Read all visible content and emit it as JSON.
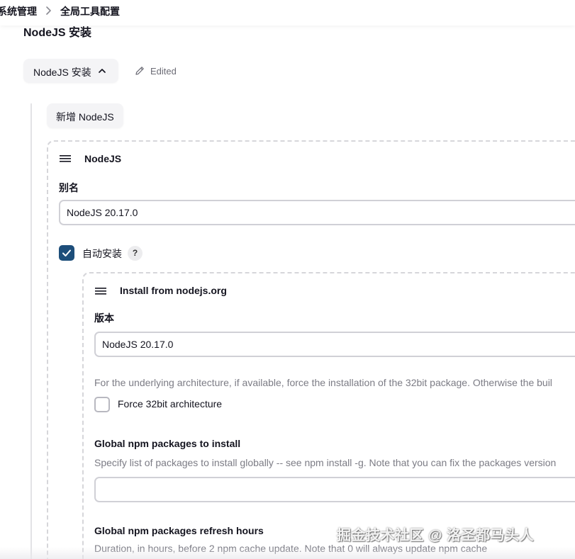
{
  "breadcrumb": {
    "items": [
      "系统管理",
      "全局工具配置"
    ],
    "separator_icon": "chevron-right-icon"
  },
  "section": {
    "title": "NodeJS 安装"
  },
  "installations_button": {
    "label": "NodeJS 安装",
    "icon": "chevron-up-icon"
  },
  "status": {
    "label": "Edited",
    "icon": "pencil-icon"
  },
  "add_button": {
    "label": "新增 NodeJS"
  },
  "nodejs_panel": {
    "title": "NodeJS",
    "handle_icon": "drag-handle-icon",
    "alias_label": "别名",
    "alias_value": "NodeJS 20.17.0",
    "auto_install_label": "自动安装",
    "auto_install_checked": true,
    "help_label": "?"
  },
  "installer_panel": {
    "title": "Install from nodejs.org",
    "handle_icon": "drag-handle-icon",
    "version_label": "版本",
    "version_value": "NodeJS 20.17.0",
    "arch_description": "For the underlying architecture, if available, force the installation of the 32bit package. Otherwise the buil",
    "force32_label": "Force 32bit architecture",
    "force32_checked": false,
    "npm_packages_label": "Global npm packages to install",
    "npm_packages_description": "Specify list of packages to install globally -- see npm install -g. Note that you can fix the packages version",
    "npm_packages_value": "",
    "refresh_label": "Global npm packages refresh hours",
    "refresh_description": "Duration, in hours, before 2 npm cache update. Note that 0 will always update npm cache"
  },
  "watermark": "掘金技术社区 @ 洛圣都马头人",
  "colors": {
    "checkbox_accent": "#1d4e7a",
    "muted_text": "#7c7c85",
    "border": "#d0d0d6"
  }
}
